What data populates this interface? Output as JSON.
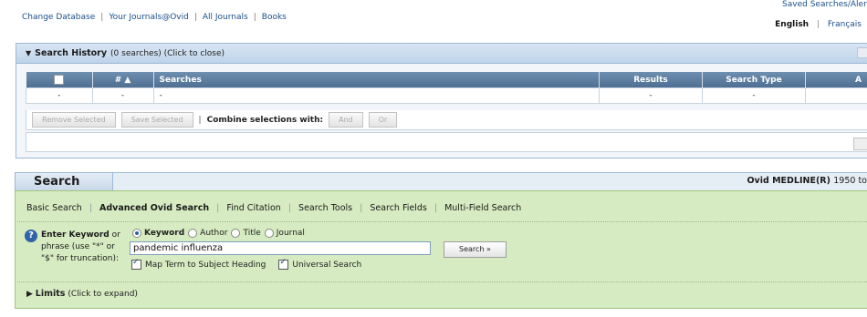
{
  "topnav": {
    "links": [
      "Change Database",
      "Your Journals@Ovid",
      "All Journals",
      "Books"
    ],
    "saved_searches": "Saved Searches/Alerts",
    "languages": [
      "English",
      "Français"
    ]
  },
  "history": {
    "title": "Search History",
    "subtitle": "(0 searches) (Click to close)",
    "columns": [
      "",
      "# ▲",
      "Searches",
      "Results",
      "Search Type",
      "A"
    ],
    "row": [
      "",
      "-",
      "-",
      "-",
      "-",
      ""
    ],
    "buttons": {
      "remove": "Remove Selected",
      "save": "Save Selected",
      "and": "And",
      "or": "Or"
    },
    "combine_label": "Combine selections with:",
    "pipe": "|"
  },
  "search": {
    "tab_label": "Search",
    "database": "Ovid MEDLINE(R)",
    "database_range": "1950 to",
    "tabs": [
      "Basic Search",
      "Advanced Ovid Search",
      "Find Citation",
      "Search Tools",
      "Search Fields",
      "Multi-Field Search"
    ],
    "active_tab": 1,
    "help_glyph": "?",
    "instruction_bold": "Enter Keyword",
    "instruction_rest": " or phrase (use \"*\" or \"$\" for truncation):",
    "radio_options": [
      "Keyword",
      "Author",
      "Title",
      "Journal"
    ],
    "selected_radio": 0,
    "query": "pandemic influenza",
    "search_button": "Search »",
    "checkboxes": [
      "Map Term to Subject Heading",
      "Universal Search"
    ],
    "limits_label": "Limits",
    "limits_hint": "(Click to expand)"
  }
}
